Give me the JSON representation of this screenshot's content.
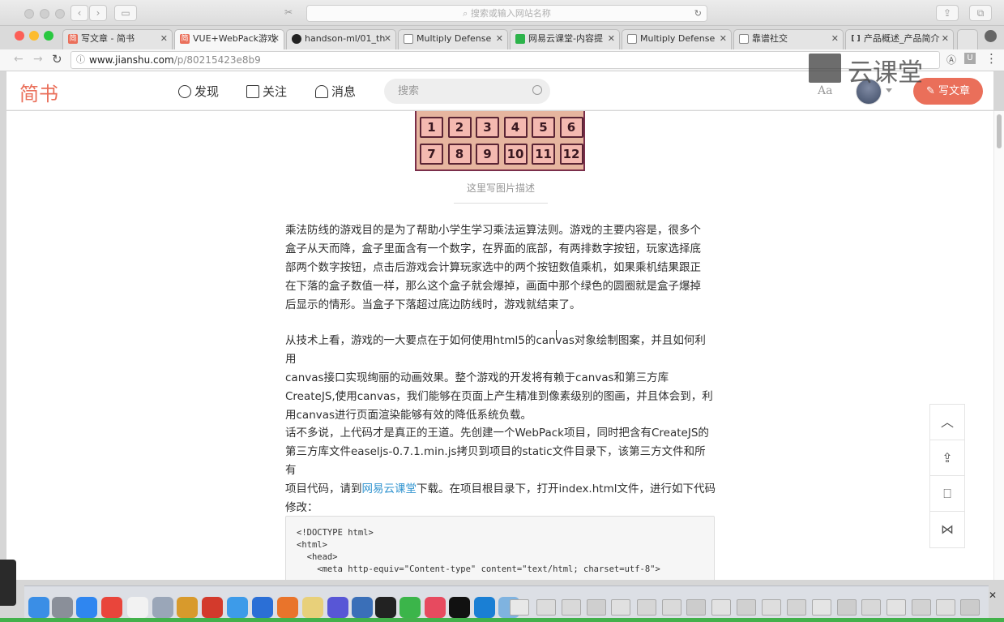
{
  "safari": {
    "search_placeholder": "搜索或输入网站名称"
  },
  "tabs": [
    {
      "title": "写文章 - 简书",
      "icon": "jianshu-icon",
      "color": "#ea6f5a",
      "glyph": "简"
    },
    {
      "title": "VUE+WebPack游戏",
      "icon": "jianshu-icon",
      "color": "#ea6f5a",
      "glyph": "简"
    },
    {
      "title": "handson-ml/01_th",
      "icon": "github-icon",
      "color": "#222222",
      "glyph": "●"
    },
    {
      "title": "Multiply Defense",
      "icon": "page-icon",
      "color": "#ffffff",
      "glyph": ""
    },
    {
      "title": "网易云课堂-内容提",
      "icon": "netease-icon",
      "color": "#2cb34a",
      "glyph": ""
    },
    {
      "title": "Multiply Defense",
      "icon": "page-icon",
      "color": "#ffffff",
      "glyph": ""
    },
    {
      "title": "靠谱社交",
      "icon": "page-icon",
      "color": "#ffffff",
      "glyph": ""
    },
    {
      "title": "产品概述_产品简介",
      "icon": "bracket-icon",
      "color": "#ffffff",
      "glyph": "[ ]"
    }
  ],
  "address": {
    "host": "www.jianshu.com",
    "path": "/p/80215423e8b9"
  },
  "nav": {
    "logo": "简书",
    "discover": "发现",
    "follow": "关注",
    "messages": "消息",
    "search_placeholder": "搜索",
    "aa": "Aa",
    "write": "写文章"
  },
  "watermark": "云课堂",
  "game_image": {
    "row1": [
      "1",
      "2",
      "3",
      "4",
      "5",
      "6"
    ],
    "row2": [
      "7",
      "8",
      "9",
      "10",
      "11",
      "12"
    ]
  },
  "caption": "这里写图片描述",
  "paragraphs": {
    "p1": [
      "乘法防线的游戏目的是为了帮助小学生学习乘法运算法则。游戏的主要内容是，很多个",
      "盒子从天而降，盒子里面含有一个数字，在界面的底部，有两排数字按钮，玩家选择底",
      "部两个数字按钮，点击后游戏会计算玩家选中的两个按钮数值乘机，如果乘机结果跟正",
      "在下落的盒子数值一样，那么这个盒子就会爆掉，画面中那个绿色的圆圈就是盒子爆掉",
      "后显示的情形。当盒子下落超过底边防线时，游戏就结束了。"
    ],
    "p2": [
      "从技术上看，游戏的一大要点在于如何使用html5的canvas对象绘制图案，并且如何利用",
      "canvas接口实现绚丽的动画效果。整个游戏的开发将有赖于canvas和第三方库",
      "CreateJS,使用canvas，我们能够在页面上产生精准到像素级别的图画，并且体会到，利",
      "用canvas进行页面渲染能够有效的降低系统负载。"
    ],
    "p3_lines": [
      "话不多说，上代码才是真正的王道。先创建一个WebPack项目，同时把含有CreateJS的",
      "第三方库文件easeljs-0.7.1.min.js拷贝到项目的static文件目录下，该第三方文件和所有"
    ],
    "p3_pre_link": "项目代码，请到",
    "p3_link": "网易云课堂",
    "p3_post_link": "下载。在项目根目录下，打开index.html文件，进行如下代码",
    "p3_last": "修改："
  },
  "code": [
    "<!DOCTYPE html>",
    "<html>",
    "  <head>",
    "    <meta http-equiv=\"Content-type\" content=\"text/html; charset=utf-8\">"
  ]
}
